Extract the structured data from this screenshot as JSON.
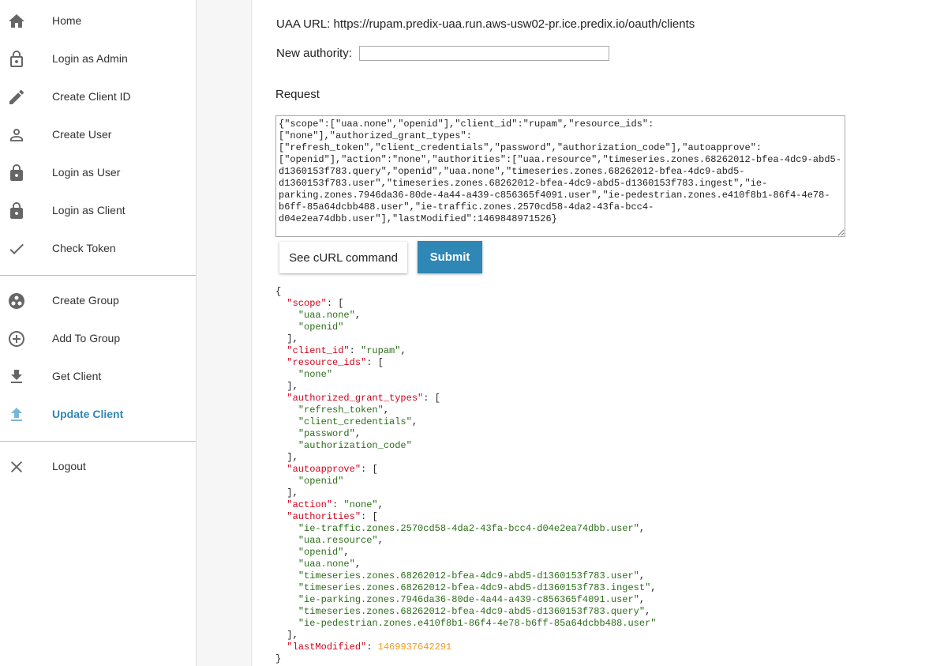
{
  "sidebar": {
    "items": [
      {
        "label": "Home",
        "icon": "home-icon"
      },
      {
        "label": "Login as Admin",
        "icon": "lock-outline-icon"
      },
      {
        "label": "Create Client ID",
        "icon": "pencil-icon"
      },
      {
        "label": "Create User",
        "icon": "person-outline-icon"
      },
      {
        "label": "Login as User",
        "icon": "lock-icon"
      },
      {
        "label": "Login as Client",
        "icon": "lock-icon"
      },
      {
        "label": "Check Token",
        "icon": "check-icon"
      },
      {
        "label": "Create Group",
        "icon": "group-work-icon"
      },
      {
        "label": "Add To Group",
        "icon": "add-circle-outline-icon"
      },
      {
        "label": "Get Client",
        "icon": "download-icon"
      },
      {
        "label": "Update Client",
        "icon": "upload-icon",
        "active": true
      },
      {
        "label": "Logout",
        "icon": "close-icon"
      }
    ]
  },
  "main": {
    "uaa_url": "UAA URL: https://rupam.predix-uaa.run.aws-usw02-pr.ice.predix.io/oauth/clients",
    "new_authority_label": "New authority:",
    "new_authority_value": "",
    "request_label": "Request",
    "request_body": "{\"scope\":[\"uaa.none\",\"openid\"],\"client_id\":\"rupam\",\"resource_ids\":[\"none\"],\"authorized_grant_types\":[\"refresh_token\",\"client_credentials\",\"password\",\"authorization_code\"],\"autoapprove\":[\"openid\"],\"action\":\"none\",\"authorities\":[\"uaa.resource\",\"timeseries.zones.68262012-bfea-4dc9-abd5-d1360153f783.query\",\"openid\",\"uaa.none\",\"timeseries.zones.68262012-bfea-4dc9-abd5-d1360153f783.user\",\"timeseries.zones.68262012-bfea-4dc9-abd5-d1360153f783.ingest\",\"ie-parking.zones.7946da36-80de-4a44-a439-c856365f4091.user\",\"ie-pedestrian.zones.e410f8b1-86f4-4e78-b6ff-85a64dcbb488.user\",\"ie-traffic.zones.2570cd58-4da2-43fa-bcc4-d04e2ea74dbb.user\"],\"lastModified\":1469848971526}",
    "curl_button": "See cURL command",
    "submit_button": "Submit"
  },
  "response": {
    "scope": [
      "uaa.none",
      "openid"
    ],
    "client_id": "rupam",
    "resource_ids": [
      "none"
    ],
    "authorized_grant_types": [
      "refresh_token",
      "client_credentials",
      "password",
      "authorization_code"
    ],
    "autoapprove": [
      "openid"
    ],
    "action": "none",
    "authorities": [
      "ie-traffic.zones.2570cd58-4da2-43fa-bcc4-d04e2ea74dbb.user",
      "uaa.resource",
      "openid",
      "uaa.none",
      "timeseries.zones.68262012-bfea-4dc9-abd5-d1360153f783.user",
      "timeseries.zones.68262012-bfea-4dc9-abd5-d1360153f783.ingest",
      "ie-parking.zones.7946da36-80de-4a44-a439-c856365f4091.user",
      "timeseries.zones.68262012-bfea-4dc9-abd5-d1360153f783.query",
      "ie-pedestrian.zones.e410f8b1-86f4-4e78-b6ff-85a64dcbb488.user"
    ],
    "lastModified": 1469937642291
  },
  "colors": {
    "accent": "#2e87b4",
    "json_key": "#d0021b",
    "json_string": "#2c6e1a",
    "json_number": "#f19a1e"
  }
}
